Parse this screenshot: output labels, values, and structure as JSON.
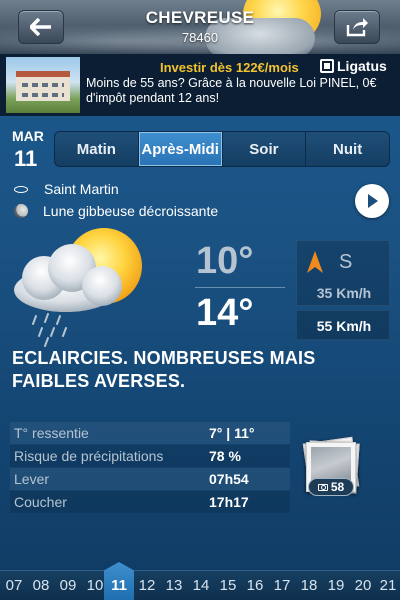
{
  "header": {
    "city": "CHEVREUSE",
    "postcode": "78460"
  },
  "ad": {
    "title": "Investir dès 122€/mois",
    "brand": "Ligatus",
    "text": "Moins de 55 ans? Grâce à la nouvelle Loi PINEL, 0€ d'impôt pendant 12 ans!"
  },
  "date": {
    "weekday": "MAR",
    "day": "11"
  },
  "tabs": [
    {
      "label": "Matin",
      "active": false
    },
    {
      "label": "Après-Midi",
      "active": true
    },
    {
      "label": "Soir",
      "active": false
    },
    {
      "label": "Nuit",
      "active": false
    }
  ],
  "info": {
    "saint": "Saint Martin",
    "moon": "Lune gibbeuse décroissante"
  },
  "weather": {
    "temp_min": "10°",
    "temp_max": "14°",
    "wind_dir": "S",
    "wind_avg": "35 Km/h",
    "wind_gust": "55 Km/h",
    "description": "ECLAIRCIES. NOMBREUSES MAIS FAIBLES AVERSES."
  },
  "details": [
    {
      "label": "T° ressentie",
      "value": "7° | 11°"
    },
    {
      "label": "Risque de précipitations",
      "value": "78 %"
    },
    {
      "label": "Lever",
      "value": "07h54"
    },
    {
      "label": "Coucher",
      "value": "17h17"
    }
  ],
  "photos": {
    "count": "58"
  },
  "days": [
    "07",
    "08",
    "09",
    "10",
    "11",
    "12",
    "13",
    "14",
    "15",
    "16",
    "17",
    "18",
    "19",
    "20",
    "21"
  ],
  "active_day": "11",
  "colors": {
    "accent": "#2a73b5",
    "sun": "#ffd54a",
    "ad_title": "#f2c230",
    "wind_arrow": "#f08a1c"
  }
}
